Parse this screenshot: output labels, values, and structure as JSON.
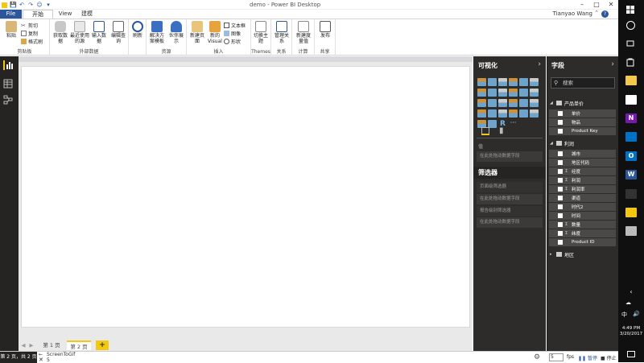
{
  "window": {
    "title": "demo - Power BI Desktop",
    "user": "Tianyao Wang"
  },
  "tabs": {
    "file": "File",
    "home": "开始",
    "view": "View",
    "modeling": "建模"
  },
  "ribbon": {
    "clipboard": {
      "label": "剪贴板",
      "paste": "粘贴",
      "cut": "剪切",
      "copy": "复制",
      "format_painter": "格式刷"
    },
    "external_data": {
      "label": "外部数据",
      "get_data": "获取数据",
      "recent_sources": "最近使用的源",
      "enter_data": "输入数据",
      "edit_queries": "编辑查询"
    },
    "refresh": "刷新",
    "resources": {
      "label": "资源",
      "solution_templates": "解决方案模板",
      "partner_showcase": "伙伴展示"
    },
    "insert": {
      "label": "插入",
      "new_page": "新建页面",
      "new_visual": "新的Visual",
      "text_box": "文本框",
      "image": "图像",
      "shapes": "形状"
    },
    "themes": {
      "label": "Themes",
      "switch_theme": "切换主题"
    },
    "relationships": {
      "label": "关系",
      "manage": "管理关系"
    },
    "calculations": {
      "label": "计算",
      "new_measure": "新建度量值"
    },
    "share": {
      "label": "共享",
      "publish": "发布"
    }
  },
  "pages": {
    "page1": "第 1 页",
    "page2": "第 2 页",
    "add": "+"
  },
  "status": {
    "page_indicator": "第 2 页，共 2 页",
    "screentogif": "ScreenToGif",
    "screentogif_count": "5",
    "fps_value": "5",
    "fps_label": "fps",
    "pause": "暂停",
    "stop": "停止"
  },
  "visualizations": {
    "header": "可视化",
    "values_label": "值",
    "drop_hint": "在此处拖动数据字段",
    "filters_header": "筛选器",
    "page_filters": "页面级筛选器",
    "report_filters": "报告级别筛选器",
    "icons": [
      "stacked-bar",
      "stacked-column",
      "clustered-bar",
      "clustered-column",
      "100-stacked-bar",
      "100-stacked-column",
      "line",
      "area",
      "stacked-area",
      "line-column",
      "line-clustered-column",
      "ribbon",
      "waterfall",
      "scatter",
      "pie",
      "donut",
      "treemap",
      "map",
      "filled-map",
      "funnel",
      "gauge",
      "multi-row-card",
      "card",
      "kpi",
      "slicer",
      "arcgis",
      "r-visual",
      "more"
    ],
    "icon_colors": {
      "bar": "#e8a33c",
      "blue": "#7ab8e8",
      "white": "#e6e6e6"
    }
  },
  "fields": {
    "header": "字段",
    "search_placeholder": "搜索",
    "tables": [
      {
        "name": "产品单价",
        "fields": [
          {
            "name": "单价",
            "sigma": false
          },
          {
            "name": "物品",
            "sigma": false
          },
          {
            "name": "Product Key",
            "sigma": false
          }
        ]
      },
      {
        "name": "利润",
        "fields": [
          {
            "name": "城市",
            "sigma": false
          },
          {
            "name": "地区代码",
            "sigma": false
          },
          {
            "name": "经度",
            "sigma": true
          },
          {
            "name": "利润",
            "sigma": true
          },
          {
            "name": "利润率",
            "sigma": true
          },
          {
            "name": "渠道",
            "sigma": false
          },
          {
            "name": "时代2",
            "sigma": false
          },
          {
            "name": "时间",
            "sigma": false
          },
          {
            "name": "数量",
            "sigma": true
          },
          {
            "name": "纬度",
            "sigma": true
          },
          {
            "name": "Product ID",
            "sigma": false
          }
        ]
      },
      {
        "name": "地区",
        "fields": []
      }
    ]
  },
  "taskbar": {
    "lang": "中",
    "time": "4:49 PM",
    "date": "3/20/2017"
  }
}
